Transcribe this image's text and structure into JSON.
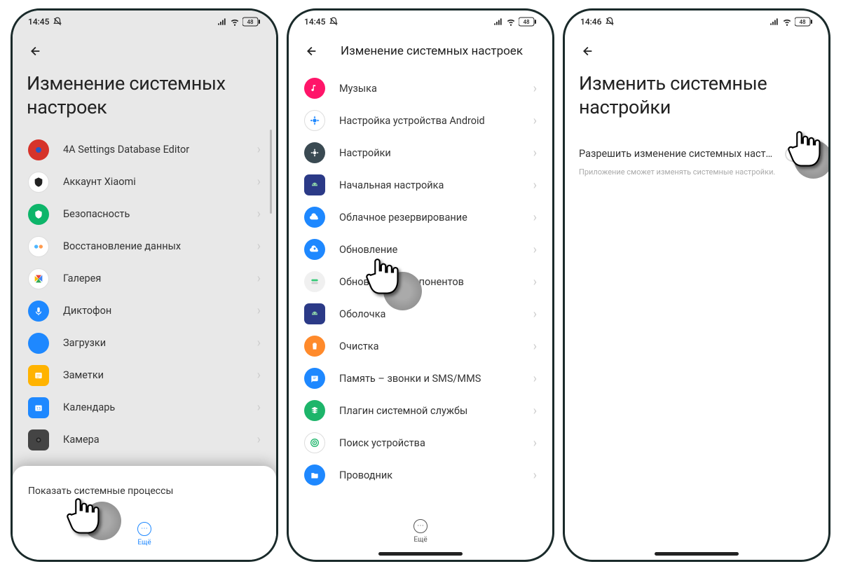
{
  "statusbar": {
    "time1": "14:45",
    "time2": "14:45",
    "time3": "14:46",
    "battery": "48"
  },
  "screen1": {
    "title": "Изменение системных настроек",
    "items": [
      {
        "label": "4A Settings Database Editor",
        "icon": "db-editor",
        "bg": "#d6332a",
        "shape": "circle"
      },
      {
        "label": "Аккаунт Xiaomi",
        "icon": "shield",
        "bg": "#ffffff",
        "shape": "circle"
      },
      {
        "label": "Безопасность",
        "icon": "security",
        "bg": "#0db56a",
        "shape": "circle"
      },
      {
        "label": "Восстановление данных",
        "icon": "restore",
        "bg": "#ffffff",
        "shape": "circle"
      },
      {
        "label": "Галерея",
        "icon": "gallery",
        "bg": "#ffffff",
        "shape": "circle"
      },
      {
        "label": "Диктофон",
        "icon": "mic",
        "bg": "#1e88ff",
        "shape": "circle"
      },
      {
        "label": "Загрузки",
        "icon": "download",
        "bg": "#1e88ff",
        "shape": "circle"
      },
      {
        "label": "Заметки",
        "icon": "notes",
        "bg": "#ffb300",
        "shape": "sq"
      },
      {
        "label": "Календарь",
        "icon": "calendar",
        "bg": "#1e88ff",
        "shape": "sq"
      },
      {
        "label": "Камера",
        "icon": "camera",
        "bg": "#444",
        "shape": "sq"
      }
    ],
    "bottomSheet": {
      "item": "Показать системные процессы"
    },
    "dock": {
      "label": "Ещё"
    }
  },
  "screen2": {
    "title": "Изменение системных настроек",
    "items": [
      {
        "label": "Музыка",
        "icon": "music",
        "bg": "#ff1569",
        "shape": "circle"
      },
      {
        "label": "Настройка устройства Android",
        "icon": "gear-blue",
        "bg": "#ffffff",
        "shape": "circle"
      },
      {
        "label": "Настройки",
        "icon": "gear-dark",
        "bg": "#3a4a52",
        "shape": "circle"
      },
      {
        "label": "Начальная настройка",
        "icon": "android",
        "bg": "#2b3a87",
        "shape": "sq"
      },
      {
        "label": "Облачное резервирование",
        "icon": "cloud",
        "bg": "#1e88ff",
        "shape": "circle"
      },
      {
        "label": "Обновление",
        "icon": "cloud-up",
        "bg": "#1e88ff",
        "shape": "circle"
      },
      {
        "label": "Обновление компонентов",
        "icon": "toggle",
        "bg": "#f0f0f0",
        "shape": "circle"
      },
      {
        "label": "Оболочка",
        "icon": "android",
        "bg": "#2b3a87",
        "shape": "sq"
      },
      {
        "label": "Очистка",
        "icon": "trash",
        "bg": "#ff8a2b",
        "shape": "circle"
      },
      {
        "label": "Память – звонки и SMS/MMS",
        "icon": "message",
        "bg": "#1e88ff",
        "shape": "circle"
      },
      {
        "label": "Плагин системной службы",
        "icon": "layers",
        "bg": "#1db56a",
        "shape": "circle"
      },
      {
        "label": "Поиск устройства",
        "icon": "find",
        "bg": "#1db56a",
        "shape": "circle"
      },
      {
        "label": "Проводник",
        "icon": "folder",
        "bg": "#1e88ff",
        "shape": "circle"
      }
    ],
    "dock": {
      "label": "Ещё"
    }
  },
  "screen3": {
    "title": "Изменить системные настройки",
    "toggle": {
      "label": "Разрешить изменение системных наст…",
      "desc": "Приложение сможет изменять системные настройки."
    }
  }
}
